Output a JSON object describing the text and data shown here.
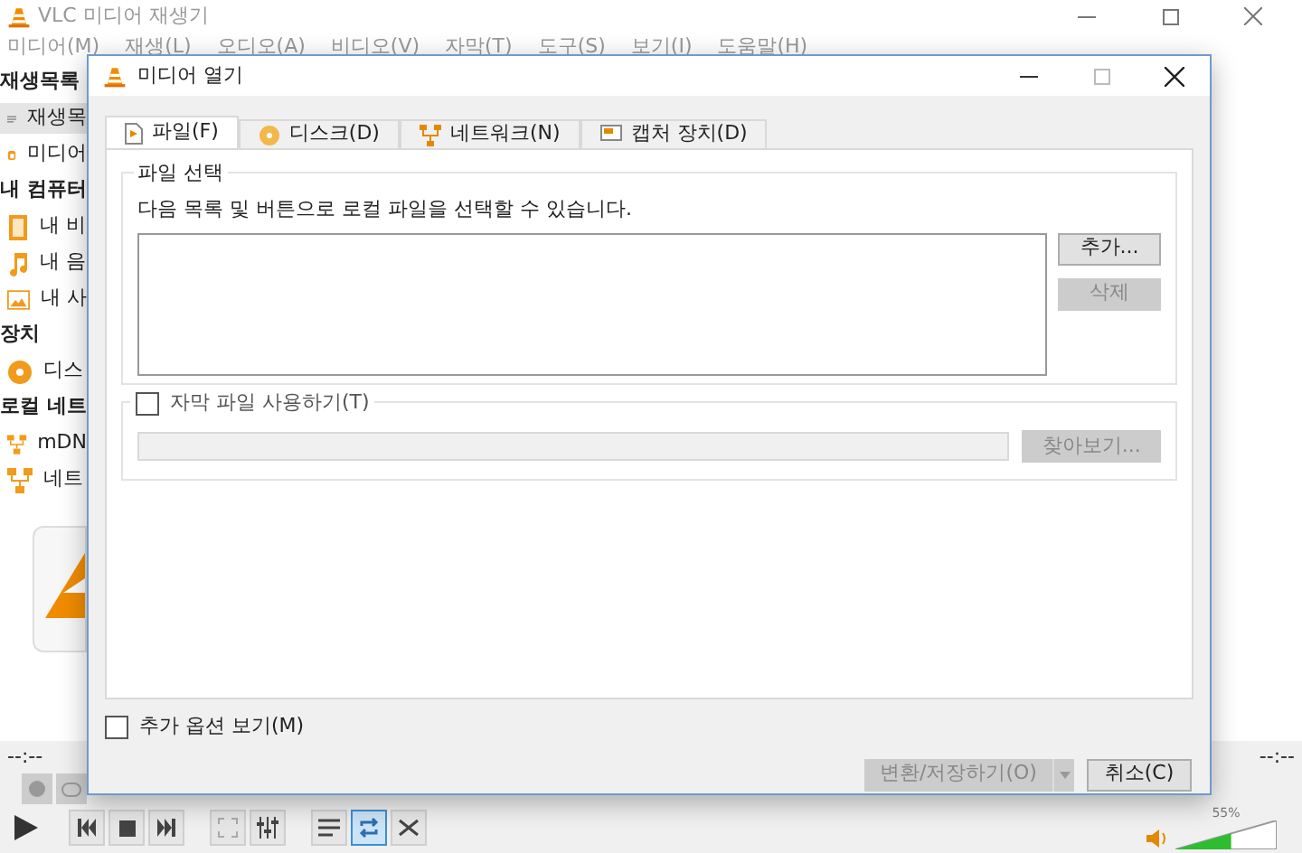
{
  "main_window": {
    "title": "VLC 미디어 재생기",
    "menu": [
      "미디어(M)",
      "재생(L)",
      "오디오(A)",
      "비디오(V)",
      "자막(T)",
      "도구(S)",
      "보기(I)",
      "도움말(H)"
    ],
    "sidebar": [
      {
        "kind": "header",
        "label": "재생목록"
      },
      {
        "kind": "item",
        "label": "재생목",
        "selected": true
      },
      {
        "kind": "item",
        "label": "미디어",
        "selected": false
      },
      {
        "kind": "header",
        "label": "내 컴퓨터"
      },
      {
        "kind": "item",
        "label": "내 비",
        "selected": false
      },
      {
        "kind": "item",
        "label": "내 음",
        "selected": false
      },
      {
        "kind": "item",
        "label": "내 사",
        "selected": false
      },
      {
        "kind": "header",
        "label": "장치"
      },
      {
        "kind": "item",
        "label": "디스",
        "selected": false
      },
      {
        "kind": "header",
        "label": "로컬 네트"
      },
      {
        "kind": "item",
        "label": "mDN",
        "selected": false
      },
      {
        "kind": "item",
        "label": "네트",
        "selected": false
      }
    ],
    "time_elapsed": "--:--",
    "time_total": "--:--",
    "toggles": [
      {
        "selected": false
      },
      {
        "selected": true
      },
      {
        "selected": false
      }
    ],
    "volume": {
      "level": 0.55,
      "reading": "55%"
    }
  },
  "dialog": {
    "title": "미디어 열기",
    "tabs": [
      {
        "label": "파일(F)",
        "selected": true
      },
      {
        "label": "디스크(D)",
        "selected": false
      },
      {
        "label": "네트워크(N)",
        "selected": false
      },
      {
        "label": "캡처 장치(D)",
        "selected": false
      }
    ],
    "file_group": {
      "title": "파일 선택",
      "description": "다음 목록 및 버튼으로 로컬 파일을 선택할 수 있습니다.",
      "add_button": {
        "label": "추가...",
        "disabled": false
      },
      "remove_button": {
        "label": "삭제",
        "disabled": true
      }
    },
    "subtitle": {
      "label": "자막 파일 사용하기(T)",
      "checked": false,
      "browse": {
        "label": "찾아보기...",
        "disabled": true
      }
    },
    "more_options": {
      "label": "추가 옵션 보기(M)",
      "checked": false
    },
    "convert_button": {
      "label": "변환/저장하기(O)",
      "disabled": true
    },
    "cancel_button": {
      "label": "취소(C)",
      "disabled": false
    }
  }
}
